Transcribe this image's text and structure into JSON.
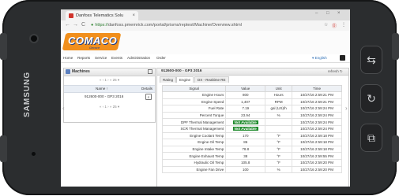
{
  "device": {
    "brand": "SAMSUNG",
    "buttons": [
      {
        "name": "back-hw-button",
        "glyph": "⇆"
      },
      {
        "name": "home-hw-button",
        "glyph": "↻"
      },
      {
        "name": "recent-hw-button",
        "glyph": "⧉"
      }
    ]
  },
  "browser": {
    "tab_title": "Danfoss Telematics Solu",
    "tab_close": "×",
    "window_controls": [
      "–",
      "□",
      "×"
    ],
    "nav": [
      "←",
      "→",
      "C"
    ],
    "url_scheme": "https://",
    "url_rest": "danfoss.pmemrick.com/portal/prisms/reptest/Machine/Overview.shtml",
    "addr_icons": [
      "☆",
      "⓪",
      "⋮"
    ]
  },
  "logo": {
    "text": "COMACO",
    "subtitle": "Gerace"
  },
  "menu": {
    "items": [
      "Home",
      "Reports",
      "Service",
      "Events",
      "Administration",
      "Order"
    ],
    "language": "▾ English"
  },
  "machines_panel": {
    "title": "Machines",
    "pager": "«  ‹   1   ›  »   25 ▾",
    "col_name": "Name ↑",
    "col_details": "Details",
    "row_name": "912600-000 - GP3 2016",
    "details_glyph": "⌕"
  },
  "detail_panel": {
    "title": "912600-000 - GP3 2016",
    "refresh": "refresh ↻",
    "tabs": [
      "Rating",
      "Engine",
      "DX - Realtime RE"
    ],
    "active_tab_index": 1,
    "columns": [
      "Signal",
      "Value",
      "Unit",
      "Time"
    ],
    "rows": [
      {
        "signal": "Engine Hours",
        "value": "800",
        "unit": "Hours",
        "time": "10/27/16 2:59:21 PM"
      },
      {
        "signal": "Engine Speed",
        "value": "1,407",
        "unit": "RPM",
        "time": "10/27/16 2:59:21 PM"
      },
      {
        "signal": "Fuel Rate",
        "value": "7.19",
        "unit": "gal (US)/h",
        "time": "10/27/16 2:59:24 PM"
      },
      {
        "signal": "Percent Torque",
        "value": "23.94",
        "unit": "%",
        "time": "10/27/16 2:59:24 PM"
      },
      {
        "signal": "DPF Thermal Management",
        "value": "Not Available",
        "unit": "",
        "time": "10/27/16 2:59:24 PM",
        "badge": true
      },
      {
        "signal": "SCR Thermal Management",
        "value": "Not Available",
        "unit": "",
        "time": "10/27/16 2:59:24 PM",
        "badge": true
      },
      {
        "signal": "Engine Coolant Temp",
        "value": "170",
        "unit": "°F",
        "time": "10/27/16 2:59:18 PM"
      },
      {
        "signal": "Engine Oil Temp",
        "value": "86",
        "unit": "°F",
        "time": "10/27/16 2:59:18 PM"
      },
      {
        "signal": "Engine Intake Temp",
        "value": "78.8",
        "unit": "°F",
        "time": "10/27/16 2:59:18 PM"
      },
      {
        "signal": "Engine Exhaust Temp",
        "value": "38",
        "unit": "°F",
        "time": "10/27/16 2:59:55 PM"
      },
      {
        "signal": "Hydraulic Oil Temp",
        "value": "105.8",
        "unit": "°F",
        "time": "10/27/16 2:59:20 PM"
      },
      {
        "signal": "Engine Fan Drive",
        "value": "100",
        "unit": "%",
        "time": "10/27/16 2:59:20 PM"
      }
    ]
  },
  "arrows": {
    "left": "‹",
    "right": "›"
  }
}
